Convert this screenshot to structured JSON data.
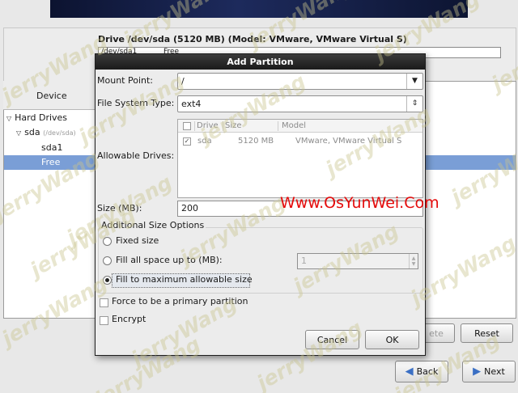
{
  "installer": {
    "drive_title": "Drive /dev/sda (5120 MB) (Model: VMware, VMware Virtual S)",
    "graph_partition": "/dev/sda1",
    "graph_free": "Free",
    "device_column": "Device",
    "tree": {
      "hard_drives": "Hard Drives",
      "sda": "sda",
      "sda_path": "(/dev/sda)",
      "sda1": "sda1",
      "free": "Free"
    },
    "buttons": {
      "delete": "ete",
      "reset": "Reset",
      "back": "Back",
      "next": "Next"
    }
  },
  "dialog": {
    "title": "Add Partition",
    "mount_point_label": "Mount Point:",
    "mount_point_value": "/",
    "fs_type_label": "File System Type:",
    "fs_type_value": "ext4",
    "allowable_drives_label": "Allowable Drives:",
    "drives_table": {
      "headers": [
        "Drive",
        "Size",
        "Model"
      ],
      "rows": [
        {
          "checked": true,
          "drive": "sda",
          "size": "5120 MB",
          "model": "VMware, VMware Virtual S"
        }
      ]
    },
    "size_label": "Size (MB):",
    "size_value": "200",
    "size_options_title": "Additional Size Options",
    "options": {
      "fixed": "Fixed size",
      "fill_up_to": "Fill all space up to (MB):",
      "fill_up_to_value": "1",
      "fill_max": "Fill to maximum allowable size",
      "selected": "fill_max"
    },
    "force_primary_label": "Force to be a primary partition",
    "encrypt_label": "Encrypt",
    "cancel_label": "Cancel",
    "ok_label": "OK"
  },
  "watermark": {
    "text": "jerryWang",
    "site": "Www.OsYunWei.Com"
  },
  "colors": {
    "selection": "#7a9ed6",
    "dialog_titlebar": "#1b1b1b",
    "site_watermark": "#e40b0b"
  }
}
